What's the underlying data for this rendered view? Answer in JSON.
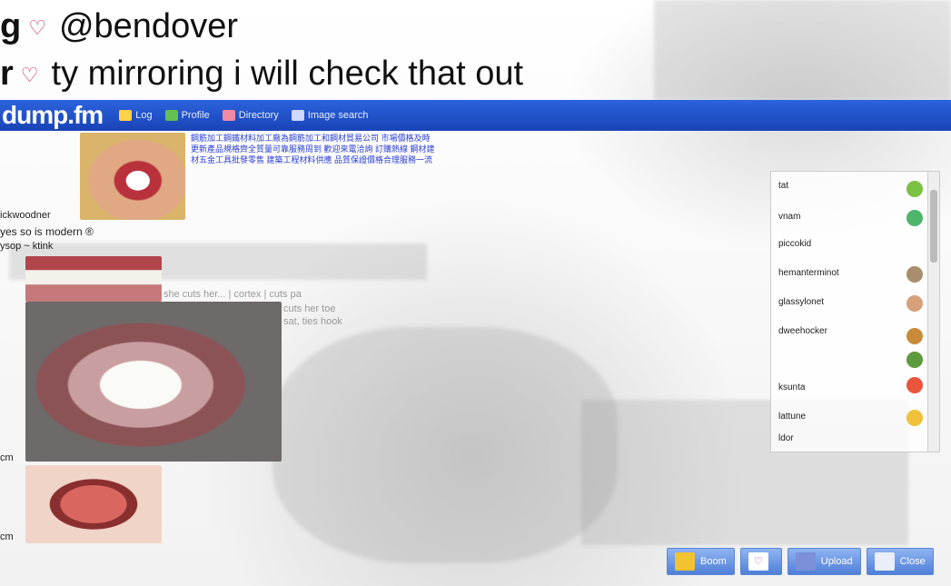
{
  "chat": {
    "line1": {
      "nick_fragment": "g",
      "heart": "♡",
      "text": "@bendover"
    },
    "line2": {
      "nick_fragment": "r",
      "heart": "♡",
      "text": "ty mirroring i will check that out"
    }
  },
  "app": {
    "logo": "dump.fm",
    "nav": [
      {
        "label": "Log",
        "icon": "log-icon"
      },
      {
        "label": "Profile",
        "icon": "profile-icon"
      },
      {
        "label": "Directory",
        "icon": "directory-icon"
      },
      {
        "label": "Image search",
        "icon": "image-search-icon"
      }
    ]
  },
  "left_labels": [
    "ickwoodner",
    "yes so is modern ®",
    "ysop ~ ktink",
    "",
    "cm",
    "cm"
  ],
  "chinese_text": "鋼筋加工鋼鐵材料加工廠為鋼筋加工和鋼材貿易公司 市場價格及時更新產品規格齊全質量可靠服務周到 歡迎來電洽詢 訂購熱線 鋼材建材五金工具批發零售 建築工程材料供應 品質保證價格合理服務一流",
  "faint_text": [
    "she cuts her... | cortex | cuts pa",
    "cuts her toe",
    "sat, ties hook"
  ],
  "userlist": {
    "users": [
      "tat",
      "vnam",
      "piccokid",
      "hemanterminot",
      "glassylonet",
      "dweehocker",
      "",
      "",
      "ksunta",
      "",
      "lattune",
      "ldor"
    ],
    "icon_names": [
      "frog-icon",
      "alien-icon",
      "claw-icon",
      "pointing-hand-icon",
      "burger-icon",
      "cactus-icon",
      "text-icon",
      "smiley-icon"
    ]
  },
  "bottom_buttons": [
    {
      "label": "Boom",
      "icon": "boom-icon"
    },
    {
      "label": "",
      "icon": "heart-icon"
    },
    {
      "label": "Upload",
      "icon": "computer-icon"
    },
    {
      "label": "Close",
      "icon": "window-icon"
    }
  ]
}
